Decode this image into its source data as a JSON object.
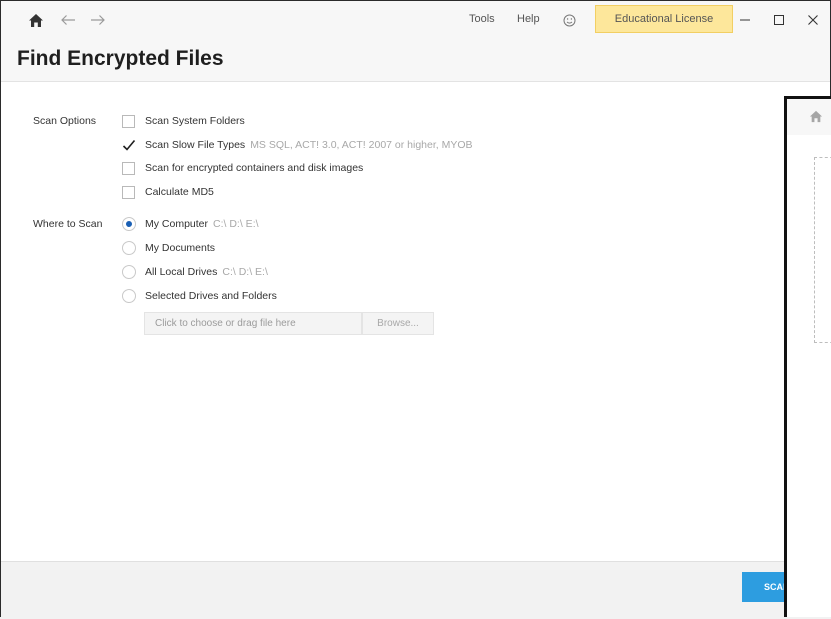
{
  "titlebar": {
    "tools_label": "Tools",
    "help_label": "Help",
    "license_label": "Educational License",
    "icons": [
      "home-icon",
      "back-arrow-icon",
      "forward-arrow-icon",
      "smiley-icon",
      "minimize-icon",
      "maximize-icon",
      "close-icon"
    ]
  },
  "page": {
    "title": "Find Encrypted Files"
  },
  "scan_options": {
    "label": "Scan Options",
    "items": [
      {
        "label": "Scan System Folders",
        "checked": false,
        "hint": ""
      },
      {
        "label": "Scan Slow File Types",
        "checked": true,
        "hint": "MS SQL, ACT! 3.0, ACT! 2007 or higher, MYOB"
      },
      {
        "label": "Scan for encrypted containers and disk images",
        "checked": false,
        "hint": ""
      },
      {
        "label": "Calculate MD5",
        "checked": false,
        "hint": ""
      }
    ]
  },
  "where_to_scan": {
    "label": "Where to Scan",
    "items": [
      {
        "label": "My Computer",
        "selected": true,
        "hint": "C:\\ D:\\ E:\\"
      },
      {
        "label": "My Documents",
        "selected": false,
        "hint": ""
      },
      {
        "label": "All Local Drives",
        "selected": false,
        "hint": "C:\\ D:\\ E:\\"
      },
      {
        "label": "Selected Drives and Folders",
        "selected": false,
        "hint": ""
      }
    ],
    "file_input_placeholder": "Click to choose or drag file here",
    "browse_label": "Browse..."
  },
  "footer": {
    "scan_label": "SCAN"
  },
  "colors": {
    "accent": "#2d9de0",
    "license_bg": "#fde79b",
    "radio_dot": "#1a5fb4"
  }
}
